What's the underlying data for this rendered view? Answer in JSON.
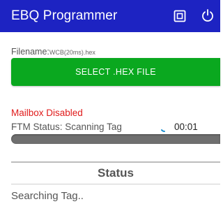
{
  "appbar": {
    "title": "EBQ Programmer",
    "background": "#1d23c2",
    "icons": [
      "chip-icon",
      "power-icon"
    ]
  },
  "file": {
    "label": "Filename:",
    "name": "WCB(20ms).hex",
    "select_button": "SELECT .HEX FILE",
    "button_color": "#0aa81f"
  },
  "status": {
    "mailbox": "Mailbox Disabled",
    "mailbox_color": "#e01a1a",
    "ftm_status": "FTM Status: Scanning Tag",
    "timer": "00:01",
    "heading": "Status",
    "message": "Searching Tag.."
  }
}
